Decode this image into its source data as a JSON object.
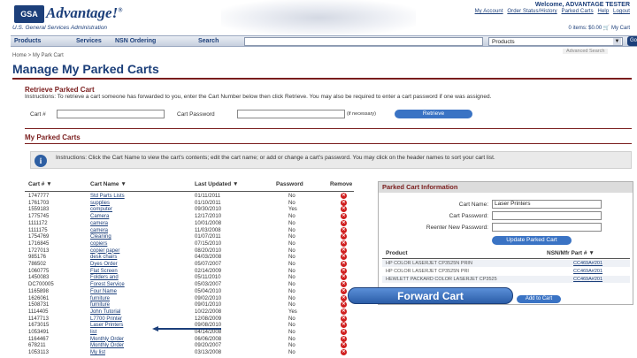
{
  "header": {
    "logo": "GSA",
    "brand": "Advantage!",
    "brand_mark": "®",
    "agency": "U.S. General Services Administration",
    "welcome": "Welcome, ADVANTAGE TESTER",
    "toplinks": [
      "My Account",
      "Order Status/History",
      "Parked Carts",
      "Help",
      "Logout"
    ],
    "cart_summary": "0 items: $0.00",
    "my_cart": "My Cart"
  },
  "nav": {
    "items": [
      "Products",
      "Services",
      "NSN Ordering"
    ],
    "search_label": "Search",
    "search_value": "",
    "select_value": "Products",
    "go_label": "Go",
    "advanced": "Advanced Search"
  },
  "breadcrumb": "Home > My Park Cart",
  "page_title": "Manage My Parked Carts",
  "retrieve": {
    "title": "Retrieve Parked Cart",
    "instructions": "Instructions: To retrieve a cart someone has forwarded to you, enter the Cart Number below then click Retrieve. You may also be required to enter a cart password if one was assigned.",
    "cart_label": "Cart #",
    "password_label": "Cart Password",
    "optional": "(if necessary)",
    "button": "Retrieve"
  },
  "parked": {
    "title": "My Parked Carts",
    "instructions": "Instructions: Click the Cart Name to view the cart's contents; edit the cart name; or add or change a cart's password. You may click on the header names to sort your cart list.",
    "columns": [
      "Cart #",
      "Cart Name",
      "Last Updated",
      "Password",
      "Remove"
    ],
    "rows": [
      {
        "num": "1747777",
        "name": "Std Parts Lists",
        "date": "01/11/2011",
        "pw": "No"
      },
      {
        "num": "1761703",
        "name": "supplies",
        "date": "01/10/2011",
        "pw": "No"
      },
      {
        "num": "1559183",
        "name": "computer",
        "date": "09/30/2010",
        "pw": "Yes"
      },
      {
        "num": "1775745",
        "name": "Camera",
        "date": "12/17/2010",
        "pw": "No"
      },
      {
        "num": "1111172",
        "name": "camera",
        "date": "10/01/2008",
        "pw": "No"
      },
      {
        "num": "1111175",
        "name": "camera",
        "date": "11/03/2008",
        "pw": "No"
      },
      {
        "num": "1754769",
        "name": "Cleaning",
        "date": "01/07/2011",
        "pw": "No"
      },
      {
        "num": "1716845",
        "name": "copiers",
        "date": "07/15/2010",
        "pw": "No"
      },
      {
        "num": "1727013",
        "name": "copier paper",
        "date": "08/20/2010",
        "pw": "No"
      },
      {
        "num": "985176",
        "name": "desk chairs",
        "date": "04/03/2008",
        "pw": "No"
      },
      {
        "num": "786502",
        "name": "Dyes Order",
        "date": "05/07/2007",
        "pw": "No"
      },
      {
        "num": "1060775",
        "name": "Flat Screen",
        "date": "02/14/2009",
        "pw": "No"
      },
      {
        "num": "1450083",
        "name": "Folders and",
        "date": "05/11/2010",
        "pw": "No"
      },
      {
        "num": "DC700005",
        "name": "Forest Service",
        "date": "05/03/2007",
        "pw": "No"
      },
      {
        "num": "1165898",
        "name": "Four Name",
        "date": "05/04/2010",
        "pw": "No"
      },
      {
        "num": "1626061",
        "name": "furniture",
        "date": "09/02/2010",
        "pw": "No"
      },
      {
        "num": "1508731",
        "name": "furniture",
        "date": "09/01/2010",
        "pw": "No"
      },
      {
        "num": "1114405",
        "name": "John Tutorial",
        "date": "10/22/2008",
        "pw": "Yes"
      },
      {
        "num": "1147713",
        "name": "L7700 Printer",
        "date": "12/08/2009",
        "pw": "No"
      },
      {
        "num": "1673015",
        "name": "Laser Printers",
        "date": "09/08/2010",
        "pw": "No"
      },
      {
        "num": "1053491",
        "name": "list",
        "date": "04/14/2008",
        "pw": "No"
      },
      {
        "num": "1164467",
        "name": "Monthly Order",
        "date": "06/06/2008",
        "pw": "No"
      },
      {
        "num": "678211",
        "name": "Monthly Order",
        "date": "09/20/2007",
        "pw": "No"
      },
      {
        "num": "1053113",
        "name": "My list",
        "date": "03/13/2008",
        "pw": "No"
      }
    ]
  },
  "panel": {
    "title": "Parked Cart Information",
    "cart_name_label": "Cart Name:",
    "cart_name_value": "Laser Printers",
    "password_label": "Cart Password:",
    "reenter_label": "Reenter New Password:",
    "update_button": "Update Parked Cart",
    "col_product": "Product",
    "col_nsn": "NSN/Mfr Part #",
    "products": [
      {
        "product": "HP COLOR LASERJET CP3525N PRIN",
        "nsn": "CC469A#201"
      },
      {
        "product": "HP COLOR LASERJET CP3525N PRI",
        "nsn": "CC469A#201"
      },
      {
        "product": "HEWLETT PACKARD COLOR LASERJET CP3525",
        "nsn": "CC469A#201"
      }
    ],
    "add_button": "Add to Cart"
  },
  "callout": "Forward Cart"
}
